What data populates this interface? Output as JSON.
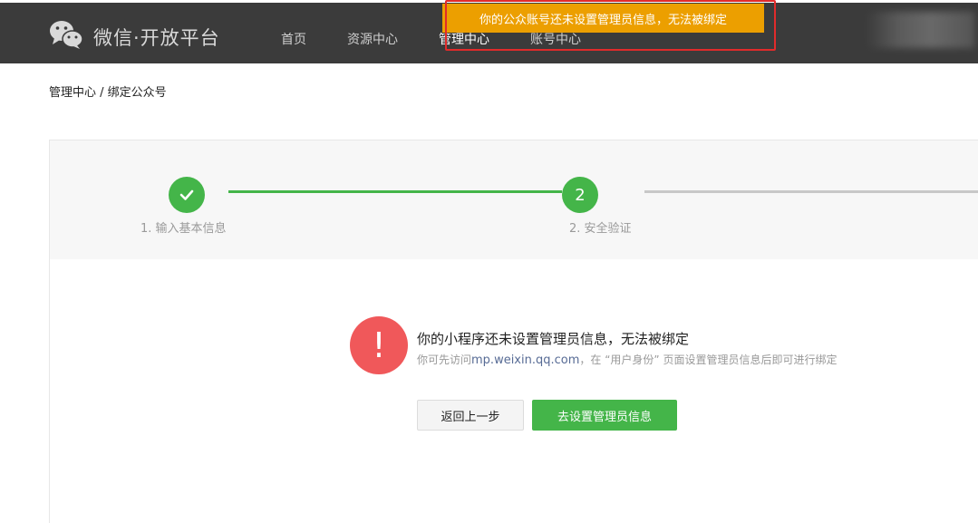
{
  "header": {
    "brand": "微信·开放平台",
    "nav": [
      {
        "label": "首页"
      },
      {
        "label": "资源中心"
      },
      {
        "label": "管理中心"
      },
      {
        "label": "账号中心"
      }
    ]
  },
  "toast": {
    "text": "你的公众账号还未设置管理员信息，无法被绑定"
  },
  "breadcrumb": "管理中心 / 绑定公众号",
  "steps": [
    {
      "label": "1. 输入基本信息",
      "status": "done"
    },
    {
      "label": "2. 安全验证",
      "number": "2",
      "status": "current"
    }
  ],
  "message": {
    "icon": "!",
    "title": "你的小程序还未设置管理员信息，无法被绑定",
    "sub_prefix": "你可先访问",
    "sub_link": "mp.weixin.qq.com",
    "sub_suffix": "，在 “用户身份” 页面设置管理员信息后即可进行绑定"
  },
  "buttons": {
    "back": "返回上一步",
    "setup": "去设置管理员信息"
  },
  "colors": {
    "navbar": "#3b3b3b",
    "accent": "#44b549",
    "toast": "#ec9f00",
    "error": "#f0585a",
    "link": "#576b95"
  }
}
